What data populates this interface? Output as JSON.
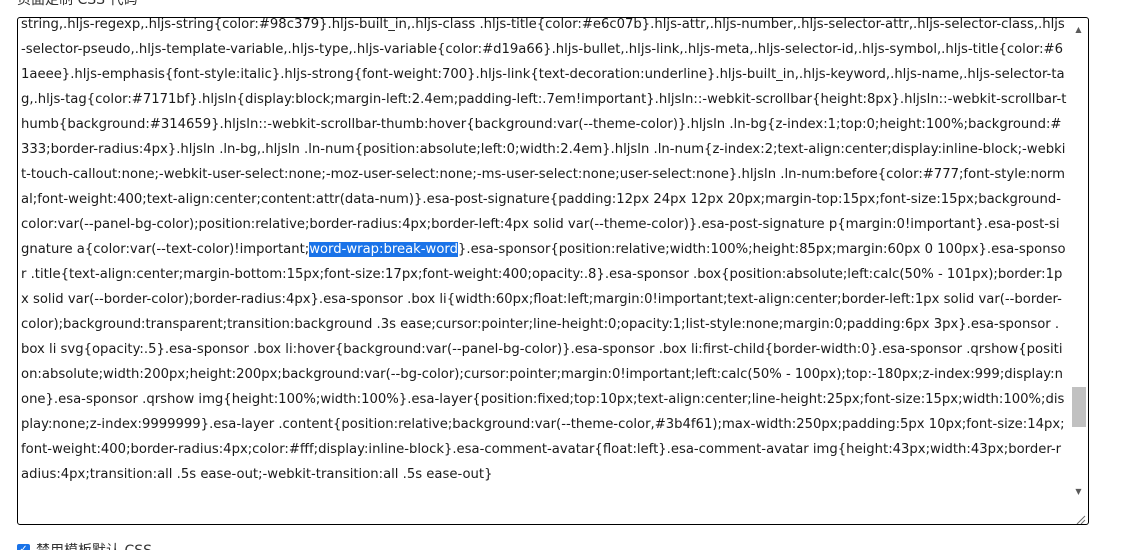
{
  "form": {
    "label": "页面定制 CSS 代码",
    "css_before_selection": "string,.hljs-regexp,.hljs-string{color:#98c379}.hljs-built_in,.hljs-class .hljs-title{color:#e6c07b}.hljs-attr,.hljs-number,.hljs-selector-attr,.hljs-selector-class,.hljs-selector-pseudo,.hljs-template-variable,.hljs-type,.hljs-variable{color:#d19a66}.hljs-bullet,.hljs-link,.hljs-meta,.hljs-selector-id,.hljs-symbol,.hljs-title{color:#61aeee}.hljs-emphasis{font-style:italic}.hljs-strong{font-weight:700}.hljs-link{text-decoration:underline}.hljs-built_in,.hljs-keyword,.hljs-name,.hljs-selector-tag,.hljs-tag{color:#7171bf}.hljsln{display:block;margin-left:2.4em;padding-left:.7em!important}.hljsln::-webkit-scrollbar{height:8px}.hljsln::-webkit-scrollbar-thumb{background:#314659}.hljsln::-webkit-scrollbar-thumb:hover{background:var(--theme-color)}.hljsln .ln-bg{z-index:1;top:0;height:100%;background:#333;border-radius:4px}.hljsln .ln-bg,.hljsln .ln-num{position:absolute;left:0;width:2.4em}.hljsln .ln-num{z-index:2;text-align:center;display:inline-block;-webkit-touch-callout:none;-webkit-user-select:none;-moz-user-select:none;-ms-user-select:none;user-select:none}.hljsln .ln-num:before{color:#777;font-style:normal;font-weight:400;text-align:center;content:attr(data-num)}.esa-post-signature{padding:12px 24px 12px 20px;margin-top:15px;font-size:15px;background-color:var(--panel-bg-color);position:relative;border-radius:4px;border-left:4px solid var(--theme-color)}.esa-post-signature p{margin:0!important}.esa-post-signature a{color:var(--text-color)!important;",
    "css_selected": "word-wrap:break-word",
    "css_after_selection": "}.esa-sponsor{position:relative;width:100%;height:85px;margin:60px 0 100px}.esa-sponsor .title{text-align:center;margin-bottom:15px;font-size:17px;font-weight:400;opacity:.8}.esa-sponsor .box{position:absolute;left:calc(50% - 101px);border:1px solid var(--border-color);border-radius:4px}.esa-sponsor .box li{width:60px;float:left;margin:0!important;text-align:center;border-left:1px solid var(--border-color);background:transparent;transition:background .3s ease;cursor:pointer;line-height:0;opacity:1;list-style:none;margin:0;padding:6px 3px}.esa-sponsor .box li svg{opacity:.5}.esa-sponsor .box li:hover{background:var(--panel-bg-color)}.esa-sponsor .box li:first-child{border-width:0}.esa-sponsor .qrshow{position:absolute;width:200px;height:200px;background:var(--bg-color);cursor:pointer;margin:0!important;left:calc(50% - 100px);top:-180px;z-index:999;display:none}.esa-sponsor .qrshow img{height:100%;width:100%}.esa-layer{position:fixed;top:10px;text-align:center;line-height:25px;font-size:15px;width:100%;display:none;z-index:9999999}.esa-layer .content{position:relative;background:var(--theme-color,#3b4f61);max-width:250px;padding:5px 10px;font-size:14px;font-weight:400;border-radius:4px;color:#fff;display:inline-block}.esa-comment-avatar{float:left}.esa-comment-avatar img{height:43px;width:43px;border-radius:4px;transition:all .5s ease-out;-webkit-transition:all .5s ease-out}",
    "checkbox_label": "禁用模板默认 CSS"
  },
  "icons": {
    "scroll_up": "scroll-up-arrow-icon",
    "scroll_down": "scroll-down-arrow-icon",
    "resize": "resize-grip-icon",
    "check": "checkmark-icon"
  },
  "colors": {
    "selection": "#1a73e8",
    "checkbox": "#1a73e8",
    "editor_border": "#000000"
  }
}
